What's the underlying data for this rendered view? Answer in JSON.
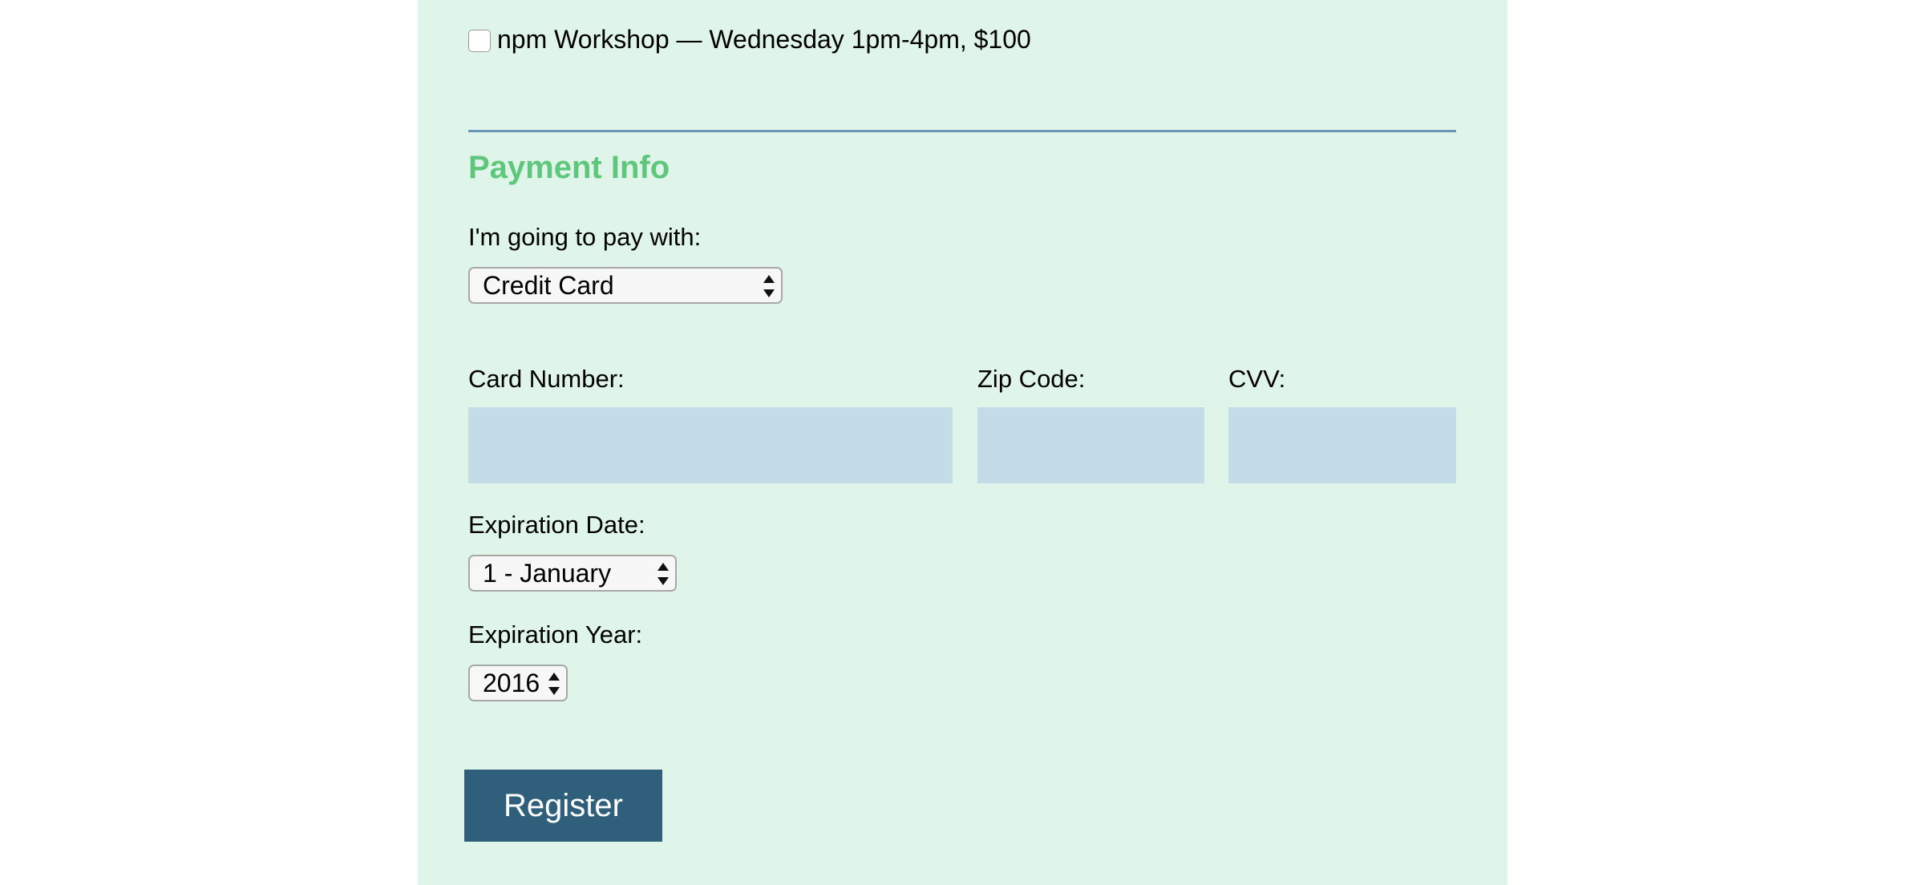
{
  "activities": {
    "npm_workshop_label": "npm Workshop — Wednesday 1pm-4pm, $100",
    "npm_workshop_checked": false
  },
  "payment": {
    "heading": "Payment Info",
    "pay_with_label": "I'm going to pay with:",
    "pay_with_selected": "Credit Card",
    "card_number_label": "Card Number:",
    "card_number_value": "",
    "zip_label": "Zip Code:",
    "zip_value": "",
    "cvv_label": "CVV:",
    "cvv_value": "",
    "exp_date_label": "Expiration Date:",
    "exp_date_selected": "1 - January",
    "exp_year_label": "Expiration Year:",
    "exp_year_selected": "2016"
  },
  "actions": {
    "register_label": "Register"
  },
  "colors": {
    "panel_background": "#e0f5ea",
    "heading_green": "#5fc77b",
    "divider_blue": "#6b93b5",
    "input_background": "#c4dce7",
    "button_background": "#2f5f7b"
  }
}
